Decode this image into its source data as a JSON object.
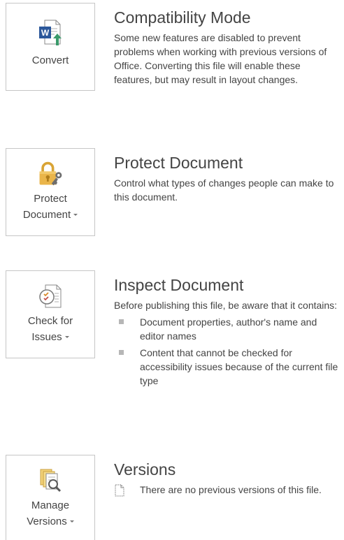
{
  "compatibility": {
    "button_label": "Convert",
    "icon": "word-convert-icon",
    "title": "Compatibility Mode",
    "description": "Some new features are disabled to prevent problems when working with previous versions of Office. Converting this file will enable these features, but may result in layout changes."
  },
  "protect": {
    "button_label_line1": "Protect",
    "button_label_line2": "Document",
    "has_dropdown": true,
    "icon": "lock-key-icon",
    "title": "Protect Document",
    "description": "Control what types of changes people can make to this document."
  },
  "inspect": {
    "button_label_line1": "Check for",
    "button_label_line2": "Issues",
    "has_dropdown": true,
    "icon": "check-issues-icon",
    "title": "Inspect Document",
    "description": "Before publishing this file, be aware that it contains:",
    "items": [
      {
        "text": "Document properties, author's name and editor names"
      },
      {
        "text": "Content that cannot be checked for accessibility issues because of the current file type"
      }
    ]
  },
  "versions": {
    "button_label_line1": "Manage",
    "button_label_line2": "Versions",
    "has_dropdown": true,
    "icon": "manage-versions-icon",
    "title": "Versions",
    "status": "There are no previous versions of this file."
  }
}
